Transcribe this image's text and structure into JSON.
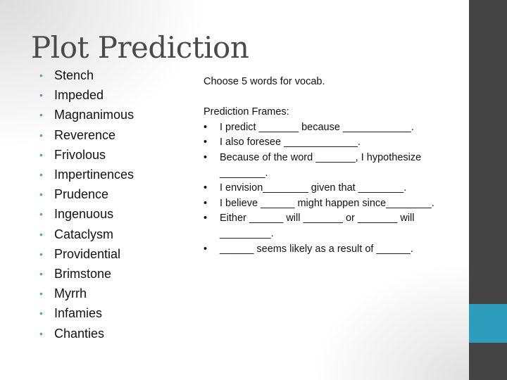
{
  "slide": {
    "title": "Plot Prediction",
    "vocab_words": [
      "Stench",
      "Impeded",
      "Magnanimous",
      "Reverence",
      "Frivolous",
      "Impertinences",
      "Prudence",
      "Ingenuous",
      "Cataclysm",
      "Providential",
      "Brimstone",
      "Myrrh",
      "Infamies",
      "Chanties"
    ],
    "instruction": "Choose 5 words for vocab.",
    "frames_heading": "Prediction Frames:",
    "frames": [
      "I predict _______ because ____________.",
      "I also foresee _____________.",
      "Because of the word _______, I hypothesize ________.",
      "I envision________ given that ________.",
      "I believe ______ might happen since________.",
      "Either ______ will _______ or _______ will _________.",
      "______ seems likely as a result of ______."
    ],
    "colors": {
      "side_band": "#444444",
      "accent": "#2e9dbd",
      "bullet": "#5aa5b8",
      "title": "#4a4a4a"
    }
  }
}
